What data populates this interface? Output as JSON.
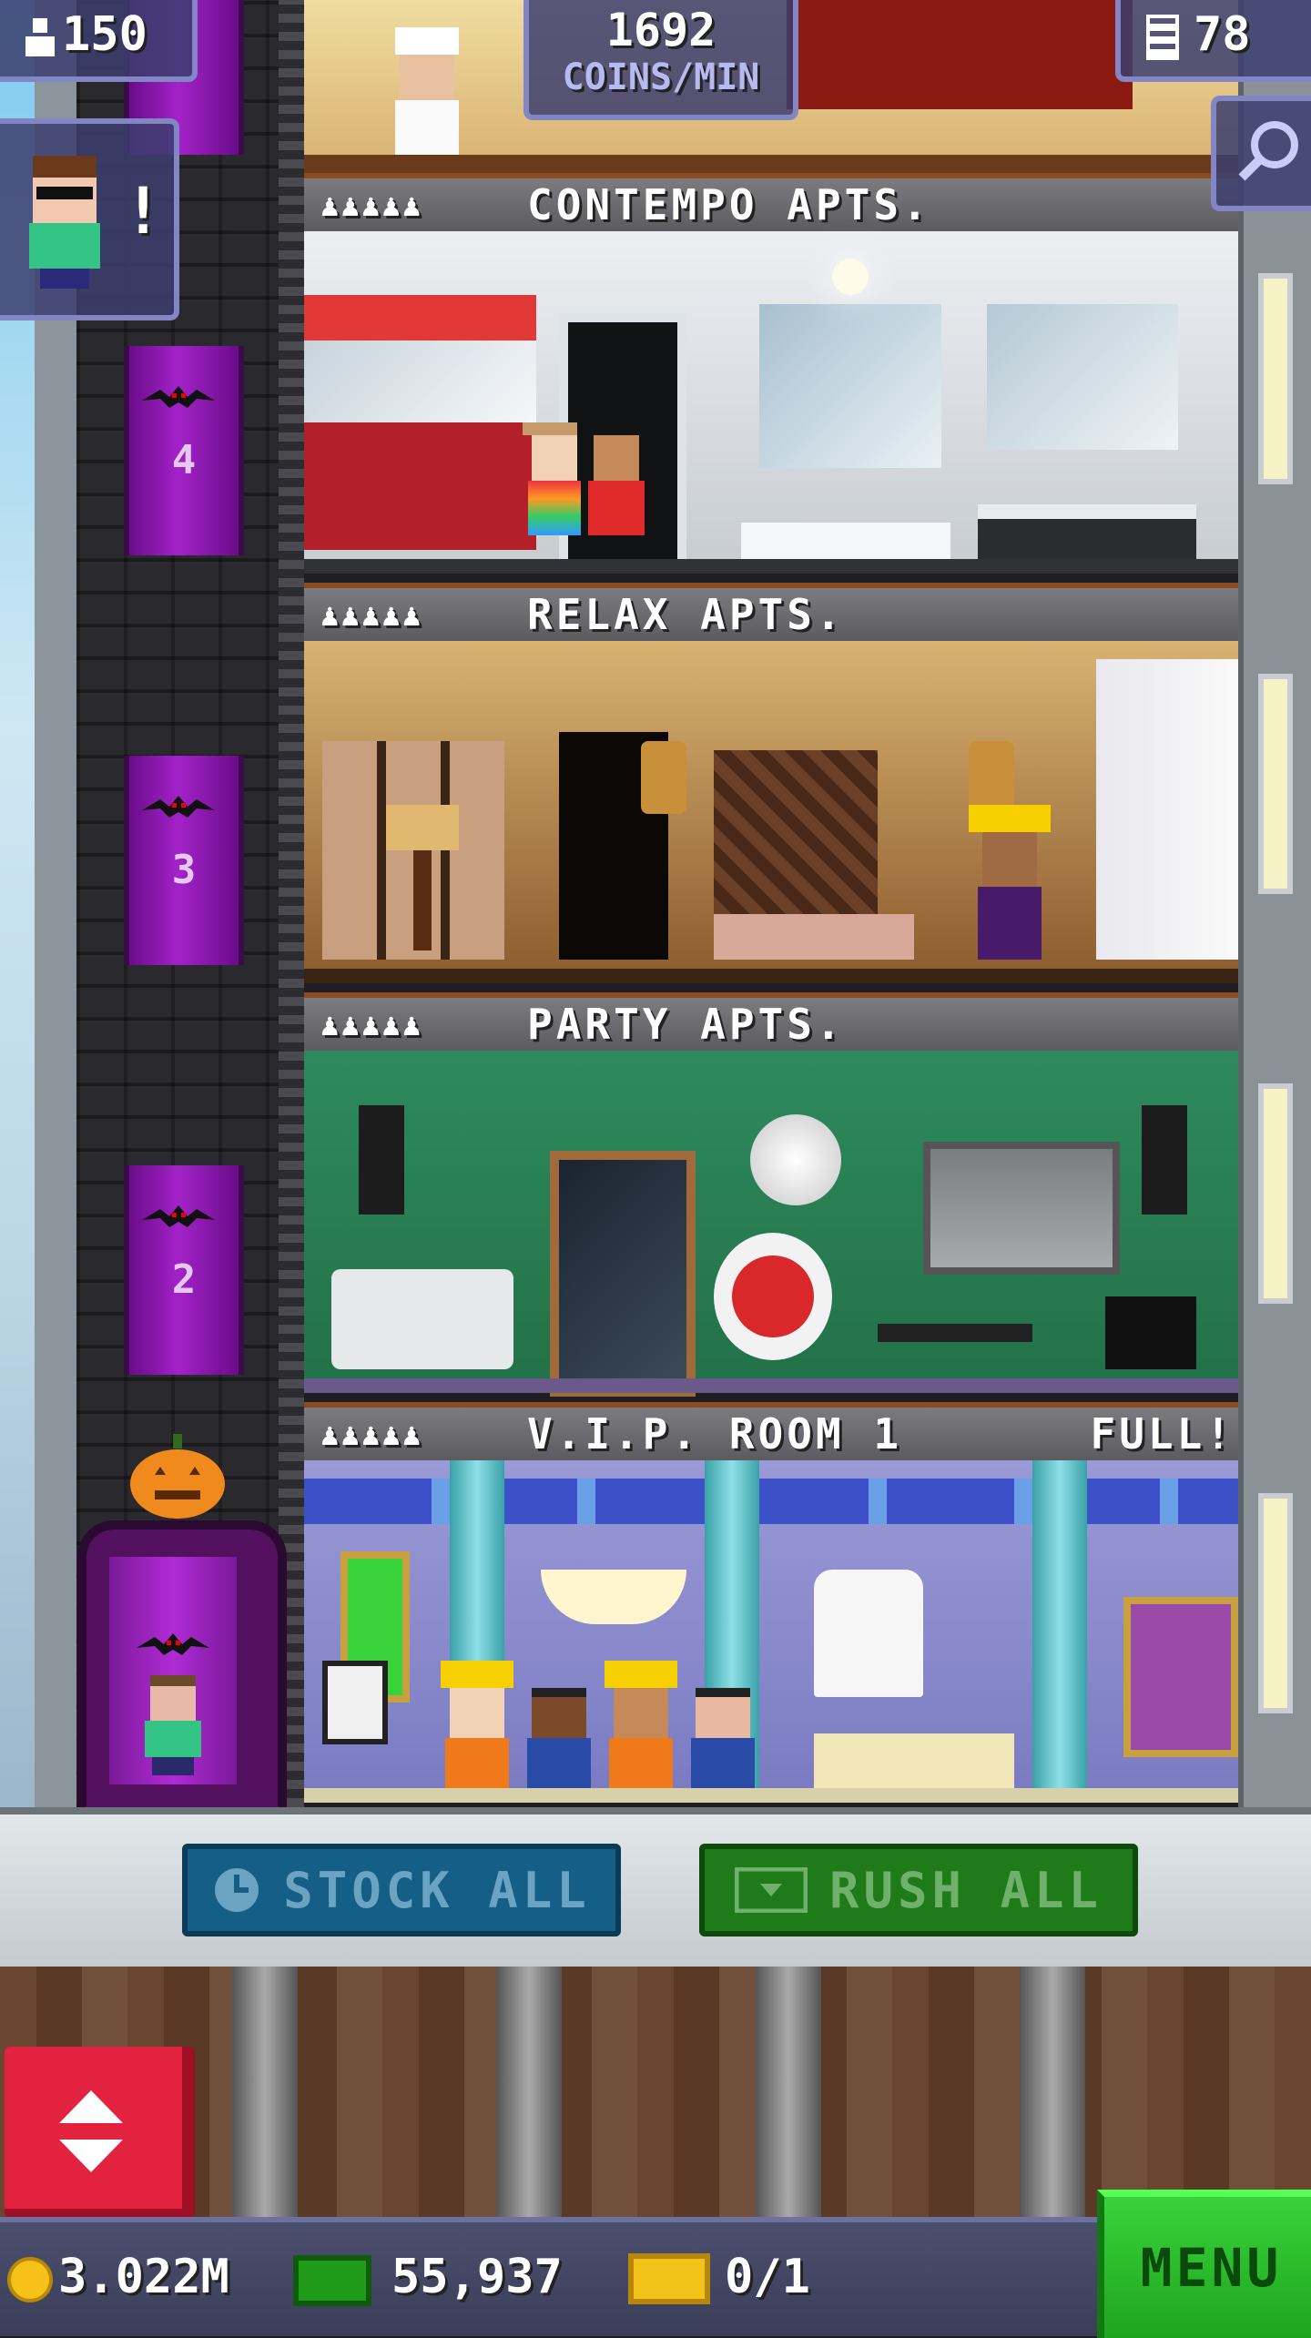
{
  "hud": {
    "population": "150",
    "rate_value": "1692",
    "rate_unit": "COINS/MIN",
    "floors_count": "78",
    "alert_mark": "!"
  },
  "floors": [
    {
      "name": "CONTEMPO APTS.",
      "status": ""
    },
    {
      "name": "RELAX APTS.",
      "status": ""
    },
    {
      "name": "PARTY APTS.",
      "status": ""
    },
    {
      "name": "V.I.P. ROOM 1",
      "status": "FULL!"
    }
  ],
  "elevator_floor_numbers": [
    "4",
    "3",
    "2"
  ],
  "actions": {
    "stock_all": "STOCK ALL",
    "rush_all": "RUSH ALL"
  },
  "status": {
    "coins": "3.022M",
    "bux": "55,937",
    "tickets": "0/1",
    "menu": "MENU"
  },
  "colors": {
    "elevator_purple": "#a322c8",
    "stock_blue": "#155f87",
    "rush_green": "#1f7a19",
    "menu_green": "#39d23a",
    "lift_red": "#e2223e"
  }
}
